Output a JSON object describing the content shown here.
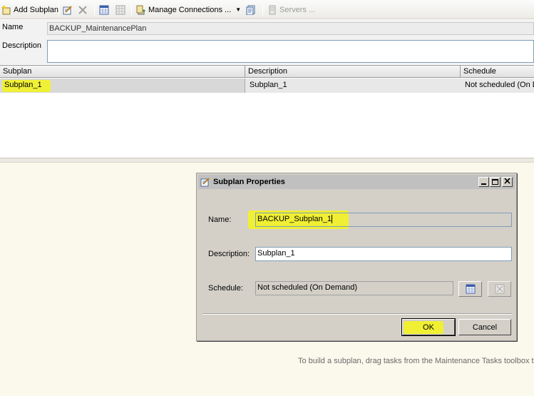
{
  "toolbar": {
    "add_subplan": "Add Subplan",
    "manage_connections": "Manage Connections ...",
    "servers": "Servers ..."
  },
  "plan": {
    "name_label": "Name",
    "name_value": "BACKUP_MaintenancePlan",
    "description_label": "Description",
    "description_value": ""
  },
  "grid": {
    "columns": [
      "Subplan",
      "Description",
      "Schedule"
    ],
    "rows": [
      {
        "subplan": "Subplan_1",
        "description": "Subplan_1",
        "schedule": "Not scheduled (On D"
      }
    ]
  },
  "hint": "To build a subplan, drag tasks from the Maintenance Tasks toolbox to",
  "dialog": {
    "title": "Subplan Properties",
    "name_label": "Name:",
    "name_value": "BACKUP_Subplan_1",
    "description_label": "Description:",
    "description_value": "Subplan_1",
    "schedule_label": "Schedule:",
    "schedule_value": "Not scheduled (On Demand)",
    "ok": "OK",
    "cancel": "Cancel"
  },
  "colors": {
    "highlight": "#f4f41a",
    "title_bar": "#c0c0c0",
    "dialog_face": "#d4d0c8",
    "surface_bottom": "#fbf8ec"
  }
}
